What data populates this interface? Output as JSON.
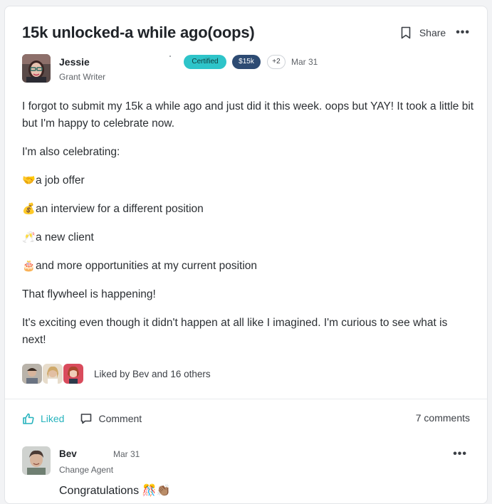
{
  "post": {
    "title": "15k unlocked-a while ago(oops)",
    "share_label": "Share",
    "more_label": "•••",
    "author": {
      "name": "Jessie",
      "role": "Grant Writer",
      "badges": [
        "Certified",
        "$15k",
        "+2"
      ],
      "date": "Mar 31"
    },
    "paragraphs": [
      "I forgot to submit my 15k a while ago and just did it this week. oops but YAY! It took a little bit but I'm happy to celebrate now.",
      "I'm also celebrating:"
    ],
    "list_items": [
      {
        "emoji": "🤝",
        "icon": "handshake-icon",
        "text": "a job offer"
      },
      {
        "emoji": "💰",
        "icon": "money-bag-icon",
        "text": "an interview for a different position"
      },
      {
        "emoji": "🥂",
        "icon": "clinking-glasses-icon",
        "text": "a new client"
      },
      {
        "emoji": "🎂",
        "icon": "birthday-cake-icon",
        "text": "and more opportunities at my current position"
      }
    ],
    "closing": [
      "That flywheel is happening!",
      "It's exciting even though it didn't happen at all like I imagined. I'm curious to see what is next!"
    ],
    "liked_by": "Liked by Bev and 16 others",
    "actions": {
      "liked_label": "Liked",
      "comment_label": "Comment",
      "comments_count": "7 comments"
    }
  },
  "comment": {
    "name": "Bev",
    "date": "Mar 31",
    "role": "Change Agent",
    "text": "Congratulations",
    "emojis": "🎊👏🏽",
    "more_label": "•••"
  },
  "colors": {
    "accent": "#27b3bd",
    "certified_badge": "#2ec4c9",
    "amount_badge": "#2d4b73"
  }
}
